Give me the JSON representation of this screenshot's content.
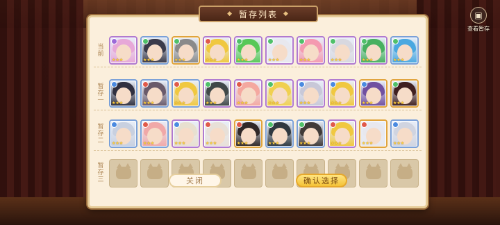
{
  "header": {
    "title": "暂存列表"
  },
  "view_stash": {
    "label": "查看暂存",
    "icon": "box-icon"
  },
  "rows": [
    {
      "label": [
        "当",
        "前"
      ],
      "slots": [
        {
          "hair": "#e7a8d8",
          "frame": "purple",
          "elem": "#9c6ad8"
        },
        {
          "hair": "#3a3a4a",
          "frame": "blue",
          "elem": "#4fc06a"
        },
        {
          "hair": "#8a8a8a",
          "frame": "gold",
          "elem": "#4fc06a"
        },
        {
          "hair": "#f0c840",
          "frame": "purple",
          "elem": "#e05a4a"
        },
        {
          "hair": "#58c858",
          "frame": "purple",
          "elem": "#4fc06a"
        },
        {
          "hair": "#e8e8ee",
          "frame": "purple",
          "elem": "#4fc06a"
        },
        {
          "hair": "#f49ab0",
          "frame": "purple",
          "elem": "#4fc06a"
        },
        {
          "hair": "#d8d8e0",
          "frame": "purple",
          "elem": "#4fc06a"
        },
        {
          "hair": "#48b060",
          "frame": "purple",
          "elem": "#4fc06a"
        },
        {
          "hair": "#4aa8e0",
          "frame": "blue",
          "elem": "#4fc06a"
        }
      ]
    },
    {
      "label": [
        "暂",
        "存",
        "一"
      ],
      "slots": [
        {
          "hair": "#303040",
          "frame": "blue",
          "elem": "#4a8ae0"
        },
        {
          "hair": "#6a5a6a",
          "frame": "blue",
          "elem": "#e05a4a"
        },
        {
          "hair": "#f0c840",
          "frame": "blue",
          "elem": "#e05a4a"
        },
        {
          "hair": "#404848",
          "frame": "purple",
          "elem": "#4fc06a"
        },
        {
          "hair": "#f4a8a0",
          "frame": "purple",
          "elem": "#e05a4a"
        },
        {
          "hair": "#f0d050",
          "frame": "purple",
          "elem": "#4fc06a"
        },
        {
          "hair": "#c8c8d8",
          "frame": "purple",
          "elem": "#4a8ae0"
        },
        {
          "hair": "#f0c840",
          "frame": "purple",
          "elem": "#4a8ae0"
        },
        {
          "hair": "#7050a0",
          "frame": "gold",
          "elem": "#4a8ae0"
        },
        {
          "hair": "#402020",
          "frame": "gold",
          "elem": "#4fc06a"
        }
      ]
    },
    {
      "label": [
        "暂",
        "存",
        "二"
      ],
      "slots": [
        {
          "hair": "#c8d0e0",
          "frame": "blue",
          "elem": "#4a8ae0"
        },
        {
          "hair": "#f0a8a8",
          "frame": "blue",
          "elem": "#e05a4a"
        },
        {
          "hair": "#e8e0d0",
          "frame": "purple",
          "elem": "#4a8ae0"
        },
        {
          "hair": "#e8e0d8",
          "frame": "purple",
          "elem": "#e05a4a"
        },
        {
          "hair": "#302828",
          "frame": "gold",
          "elem": "#e05a4a"
        },
        {
          "hair": "#303840",
          "frame": "blue",
          "elem": "#4fc06a"
        },
        {
          "hair": "#403a38",
          "frame": "blue",
          "elem": "#4fc06a"
        },
        {
          "hair": "#f0c840",
          "frame": "purple",
          "elem": "#e05a4a"
        },
        {
          "hair": "#e8e8ee",
          "frame": "gold",
          "elem": "#e05a4a"
        },
        {
          "hair": "#d0d4e0",
          "frame": "blue",
          "elem": "#4a8ae0"
        }
      ]
    },
    {
      "label": [
        "暂",
        "存",
        "三"
      ],
      "slots": [
        {
          "empty": true
        },
        {
          "empty": true
        },
        {
          "empty": true
        },
        {
          "empty": true
        },
        {
          "empty": true
        },
        {
          "empty": true
        },
        {
          "empty": true
        },
        {
          "empty": true
        },
        {
          "empty": true
        },
        {
          "empty": true
        }
      ]
    }
  ],
  "buttons": {
    "close": "关闭",
    "confirm": "确认选择"
  }
}
